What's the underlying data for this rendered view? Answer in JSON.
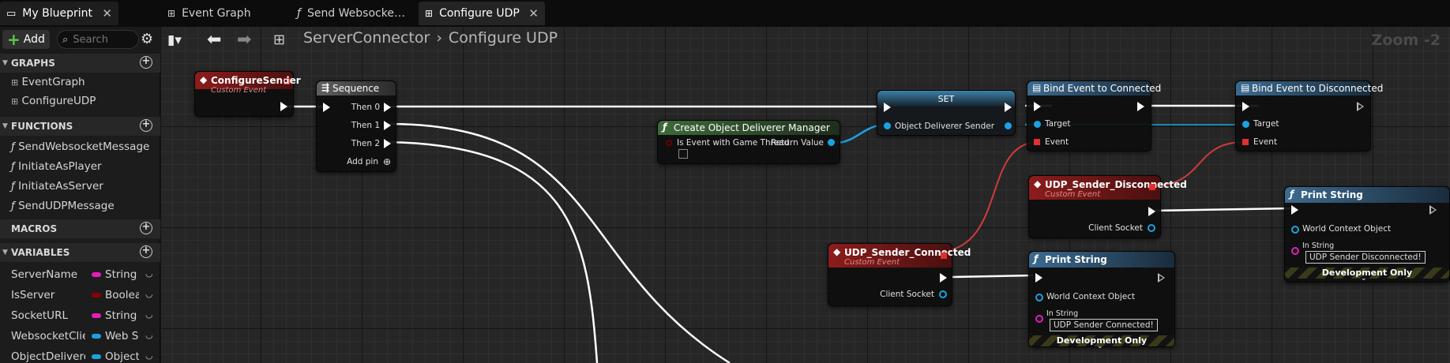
{
  "tabs": [
    {
      "label": "My Blueprint",
      "close": "✕"
    },
    {
      "label": "Event Graph"
    },
    {
      "label": "Send Websocke…"
    },
    {
      "label": "Configure UDP",
      "close": "✕"
    }
  ],
  "left": {
    "add_label": "Add",
    "search_placeholder": "Search",
    "graphs_header": "GRAPHS",
    "graphs": [
      "EventGraph",
      "ConfigureUDP"
    ],
    "functions_header": "FUNCTIONS",
    "functions": [
      "SendWebsocketMessage",
      "InitiateAsPlayer",
      "InitiateAsServer",
      "SendUDPMessage"
    ],
    "macros_header": "MACROS",
    "variables_header": "VARIABLES",
    "variables": [
      {
        "name": "ServerName",
        "type": "String",
        "color": "#e11fb8"
      },
      {
        "name": "IsServer",
        "type": "Boolean",
        "color": "#8c0000"
      },
      {
        "name": "SocketURL",
        "type": "String",
        "color": "#e11fb8"
      },
      {
        "name": "WebsocketClient",
        "type": "Web Socket",
        "color": "#1aa3e0"
      },
      {
        "name": "ObjectDelivererSender",
        "type": "Object",
        "color": "#1aa3e0"
      }
    ]
  },
  "graph": {
    "breadcrumb": [
      "ServerConnector",
      "Configure UDP"
    ],
    "zoom": "Zoom -2",
    "nodes": {
      "configure_sender": {
        "title": "ConfigureSender",
        "subtitle": "Custom Event"
      },
      "sequence": {
        "title": "Sequence",
        "then0": "Then 0",
        "then1": "Then 1",
        "then2": "Then 2",
        "add_pin": "Add pin"
      },
      "create_odm": {
        "title": "Create Object Deliverer Manager",
        "is_event": "Is Event with Game Thread",
        "return_value": "Return Value"
      },
      "set": {
        "title": "SET",
        "pin": "Object Deliverer Sender"
      },
      "bind_connected": {
        "title": "Bind Event to Connected",
        "target": "Target",
        "event": "Event"
      },
      "bind_disconnected": {
        "title": "Bind Event to Disconnected",
        "target": "Target",
        "event": "Event"
      },
      "udp_disconnected": {
        "title": "UDP_Sender_Disconnected",
        "subtitle": "Custom Event",
        "socket": "Client Socket"
      },
      "udp_connected": {
        "title": "UDP_Sender_Connected",
        "subtitle": "Custom Event",
        "socket": "Client Socket"
      },
      "print1": {
        "title": "Print String",
        "world": "World Context Object",
        "in_string": "In String",
        "value": "UDP Sender Connected!",
        "footer": "Development Only"
      },
      "print2": {
        "title": "Print String",
        "world": "World Context Object",
        "in_string": "In String",
        "value": "UDP Sender Disconnected!",
        "footer": "Development Only"
      }
    }
  }
}
